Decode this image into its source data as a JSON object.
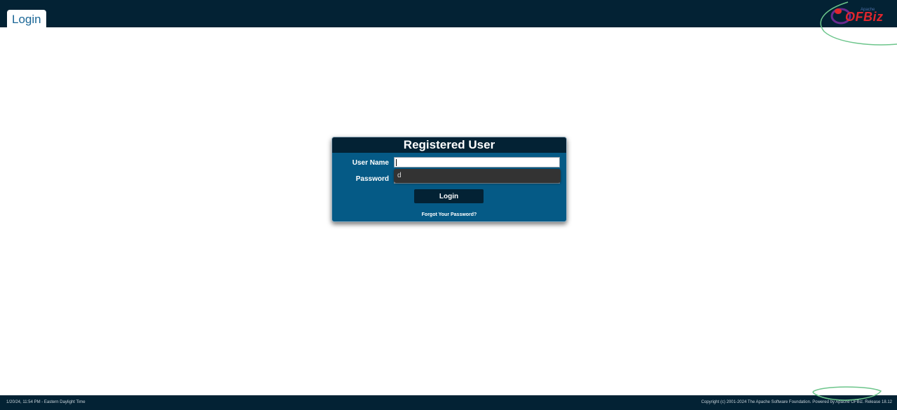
{
  "header": {
    "tab_label": "Login",
    "logo_text": "OFBiz",
    "logo_small": "Apache"
  },
  "login": {
    "title": "Registered User",
    "username_label": "User Name",
    "username_value": "",
    "password_label": "Password",
    "autocomplete_suggestion": "d",
    "submit_label": "Login",
    "forgot_link": "Forgot Your Password?"
  },
  "footer": {
    "datetime": "1/20/24, 11:54 PM - Eastern Daylight Time",
    "copyright": "Copyright (c) 2001-2024 The Apache Software Foundation. Powered by Apache OFBiz. Release 18.12"
  },
  "colors": {
    "header_bg": "#032234",
    "panel_bg": "#055a86",
    "tab_text": "#1a6696",
    "annotation": "#6cc58b"
  }
}
